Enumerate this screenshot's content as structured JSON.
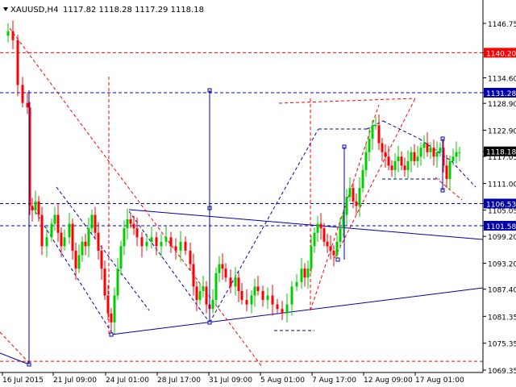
{
  "header": {
    "collapse_icon": "triangle-down-icon",
    "symbol_label": "XAUUSD,H4",
    "ohlc_text": "1117.82 1118.28 1117.29 1118.18"
  },
  "colors": {
    "background": "#ffffff",
    "axis": "#000000",
    "bull": "#00cc00",
    "bear": "#ff0000",
    "blue_line": "#0000aa",
    "red_line": "#ff0000",
    "label_red": "#ff0000",
    "label_blue": "#0000aa",
    "current_price": "#000000"
  },
  "chart_data": {
    "type": "candlestick",
    "symbol": "XAUUSD",
    "timeframe": "H4",
    "ylim": [
      1067.5,
      1150.5
    ],
    "y_ticks": [
      "1146.75",
      "1140.20",
      "1134.60",
      "1131.28",
      "1128.90",
      "1122.90",
      "1118.18",
      "1117.05",
      "1111.00",
      "1106.53",
      "1105.05",
      "1101.58",
      "1099.20",
      "1093.20",
      "1087.40",
      "1081.35",
      "1075.35",
      "1069.35"
    ],
    "y_tick_values": [
      1146.75,
      1134.6,
      1128.9,
      1122.9,
      1117.05,
      1111.0,
      1105.05,
      1099.2,
      1093.2,
      1087.4,
      1081.35,
      1075.35,
      1069.35
    ],
    "x_ticks": [
      "16 Jul 2015",
      "21 Jul 09:00",
      "24 Jul 01:00",
      "28 Jul 17:00",
      "31 Jul 09:00",
      "5 Aug 01:00",
      "7 Aug 17:00",
      "12 Aug 09:00",
      "17 Aug 01:00"
    ],
    "price_labels": [
      {
        "text": "1140.20",
        "value": 1140.2,
        "style": "red"
      },
      {
        "text": "1131.28",
        "value": 1131.28,
        "style": "blue"
      },
      {
        "text": "1118.18",
        "value": 1118.18,
        "style": "current"
      },
      {
        "text": "1106.53",
        "value": 1106.53,
        "style": "blue"
      },
      {
        "text": "1101.58",
        "value": 1101.58,
        "style": "blue"
      }
    ],
    "horizontal_lines": [
      {
        "value": 1140.2,
        "style": "red"
      },
      {
        "value": 1131.28,
        "style": "blue"
      },
      {
        "value": 1106.53,
        "style": "blue"
      },
      {
        "value": 1101.58,
        "style": "blue"
      },
      {
        "value": 1071.3,
        "style": "red"
      }
    ],
    "last_price": 1118.18
  }
}
